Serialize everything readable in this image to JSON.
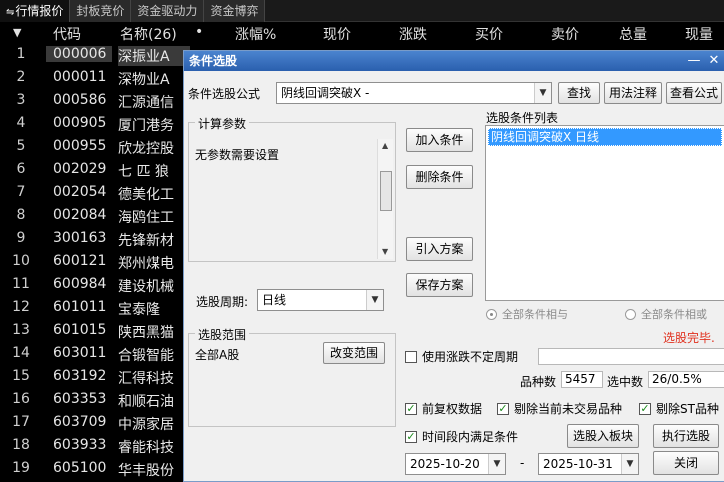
{
  "tabs": [
    "行情报价",
    "封板竞价",
    "资金驱动力",
    "资金博弈"
  ],
  "columns": {
    "sort": "▼",
    "code": "代码",
    "name": "名称(26)",
    "dot": "•",
    "change_pct": "涨幅%",
    "price": "现价",
    "change": "涨跌",
    "bid": "买价",
    "ask": "卖价",
    "volume": "总量",
    "current_vol": "现量"
  },
  "rows": [
    {
      "idx": "1",
      "code": "000006",
      "name": "深振业A"
    },
    {
      "idx": "2",
      "code": "000011",
      "name": "深物业A"
    },
    {
      "idx": "3",
      "code": "000586",
      "name": "汇源通信"
    },
    {
      "idx": "4",
      "code": "000905",
      "name": "厦门港务"
    },
    {
      "idx": "5",
      "code": "000955",
      "name": "欣龙控股"
    },
    {
      "idx": "6",
      "code": "002029",
      "name": "七 匹 狼"
    },
    {
      "idx": "7",
      "code": "002054",
      "name": "德美化工"
    },
    {
      "idx": "8",
      "code": "002084",
      "name": "海鸥住工"
    },
    {
      "idx": "9",
      "code": "300163",
      "name": "先锋新材"
    },
    {
      "idx": "10",
      "code": "600121",
      "name": "郑州煤电"
    },
    {
      "idx": "11",
      "code": "600984",
      "name": "建设机械"
    },
    {
      "idx": "12",
      "code": "601011",
      "name": "宝泰隆"
    },
    {
      "idx": "13",
      "code": "601015",
      "name": "陕西黑猫"
    },
    {
      "idx": "14",
      "code": "603011",
      "name": "合锻智能"
    },
    {
      "idx": "15",
      "code": "603192",
      "name": "汇得科技"
    },
    {
      "idx": "16",
      "code": "603353",
      "name": "和顺石油"
    },
    {
      "idx": "17",
      "code": "603709",
      "name": "中源家居"
    },
    {
      "idx": "18",
      "code": "603933",
      "name": "睿能科技"
    },
    {
      "idx": "19",
      "code": "605100",
      "name": "华丰股份"
    }
  ],
  "dialog": {
    "title": "条件选股",
    "formula_label": "条件选股公式",
    "formula_value": "阴线回调突破X  -",
    "find_button": "查找",
    "usage_button": "用法注释",
    "view_formula_button": "查看公式",
    "params_title": "计算参数",
    "params_text": "无参数需要设置",
    "add_condition": "加入条件",
    "delete_condition": "删除条件",
    "import_plan": "引入方案",
    "save_plan": "保存方案",
    "list_title": "选股条件列表",
    "list_items": [
      "阴线回调突破X  日线"
    ],
    "period_label": "选股周期:",
    "period_value": "日线",
    "radio_and": "全部条件相与",
    "radio_or": "全部条件相或",
    "status_text": "选股完毕.",
    "range_title": "选股范围",
    "range_value": "全部A股",
    "change_range": "改变范围",
    "use_period_label": "使用涨跌不定周期",
    "count_label": "品种数",
    "count_value": "5457",
    "selected_label": "选中数",
    "selected_value": "26/0.5%",
    "pre_adjust": "前复权数据",
    "exclude_suspended": "剔除当前未交易品种",
    "exclude_st": "剔除ST品种",
    "time_range_label": "时间段内满足条件",
    "add_to_block": "选股入板块",
    "execute": "执行选股",
    "date_from": "2025-10-20",
    "date_sep": "-",
    "date_to": "2025-10-31",
    "close": "关闭"
  },
  "colors": {
    "status_red": "#e0301e",
    "selection_blue": "#3399ff",
    "title_blue": "#3a72c2"
  }
}
